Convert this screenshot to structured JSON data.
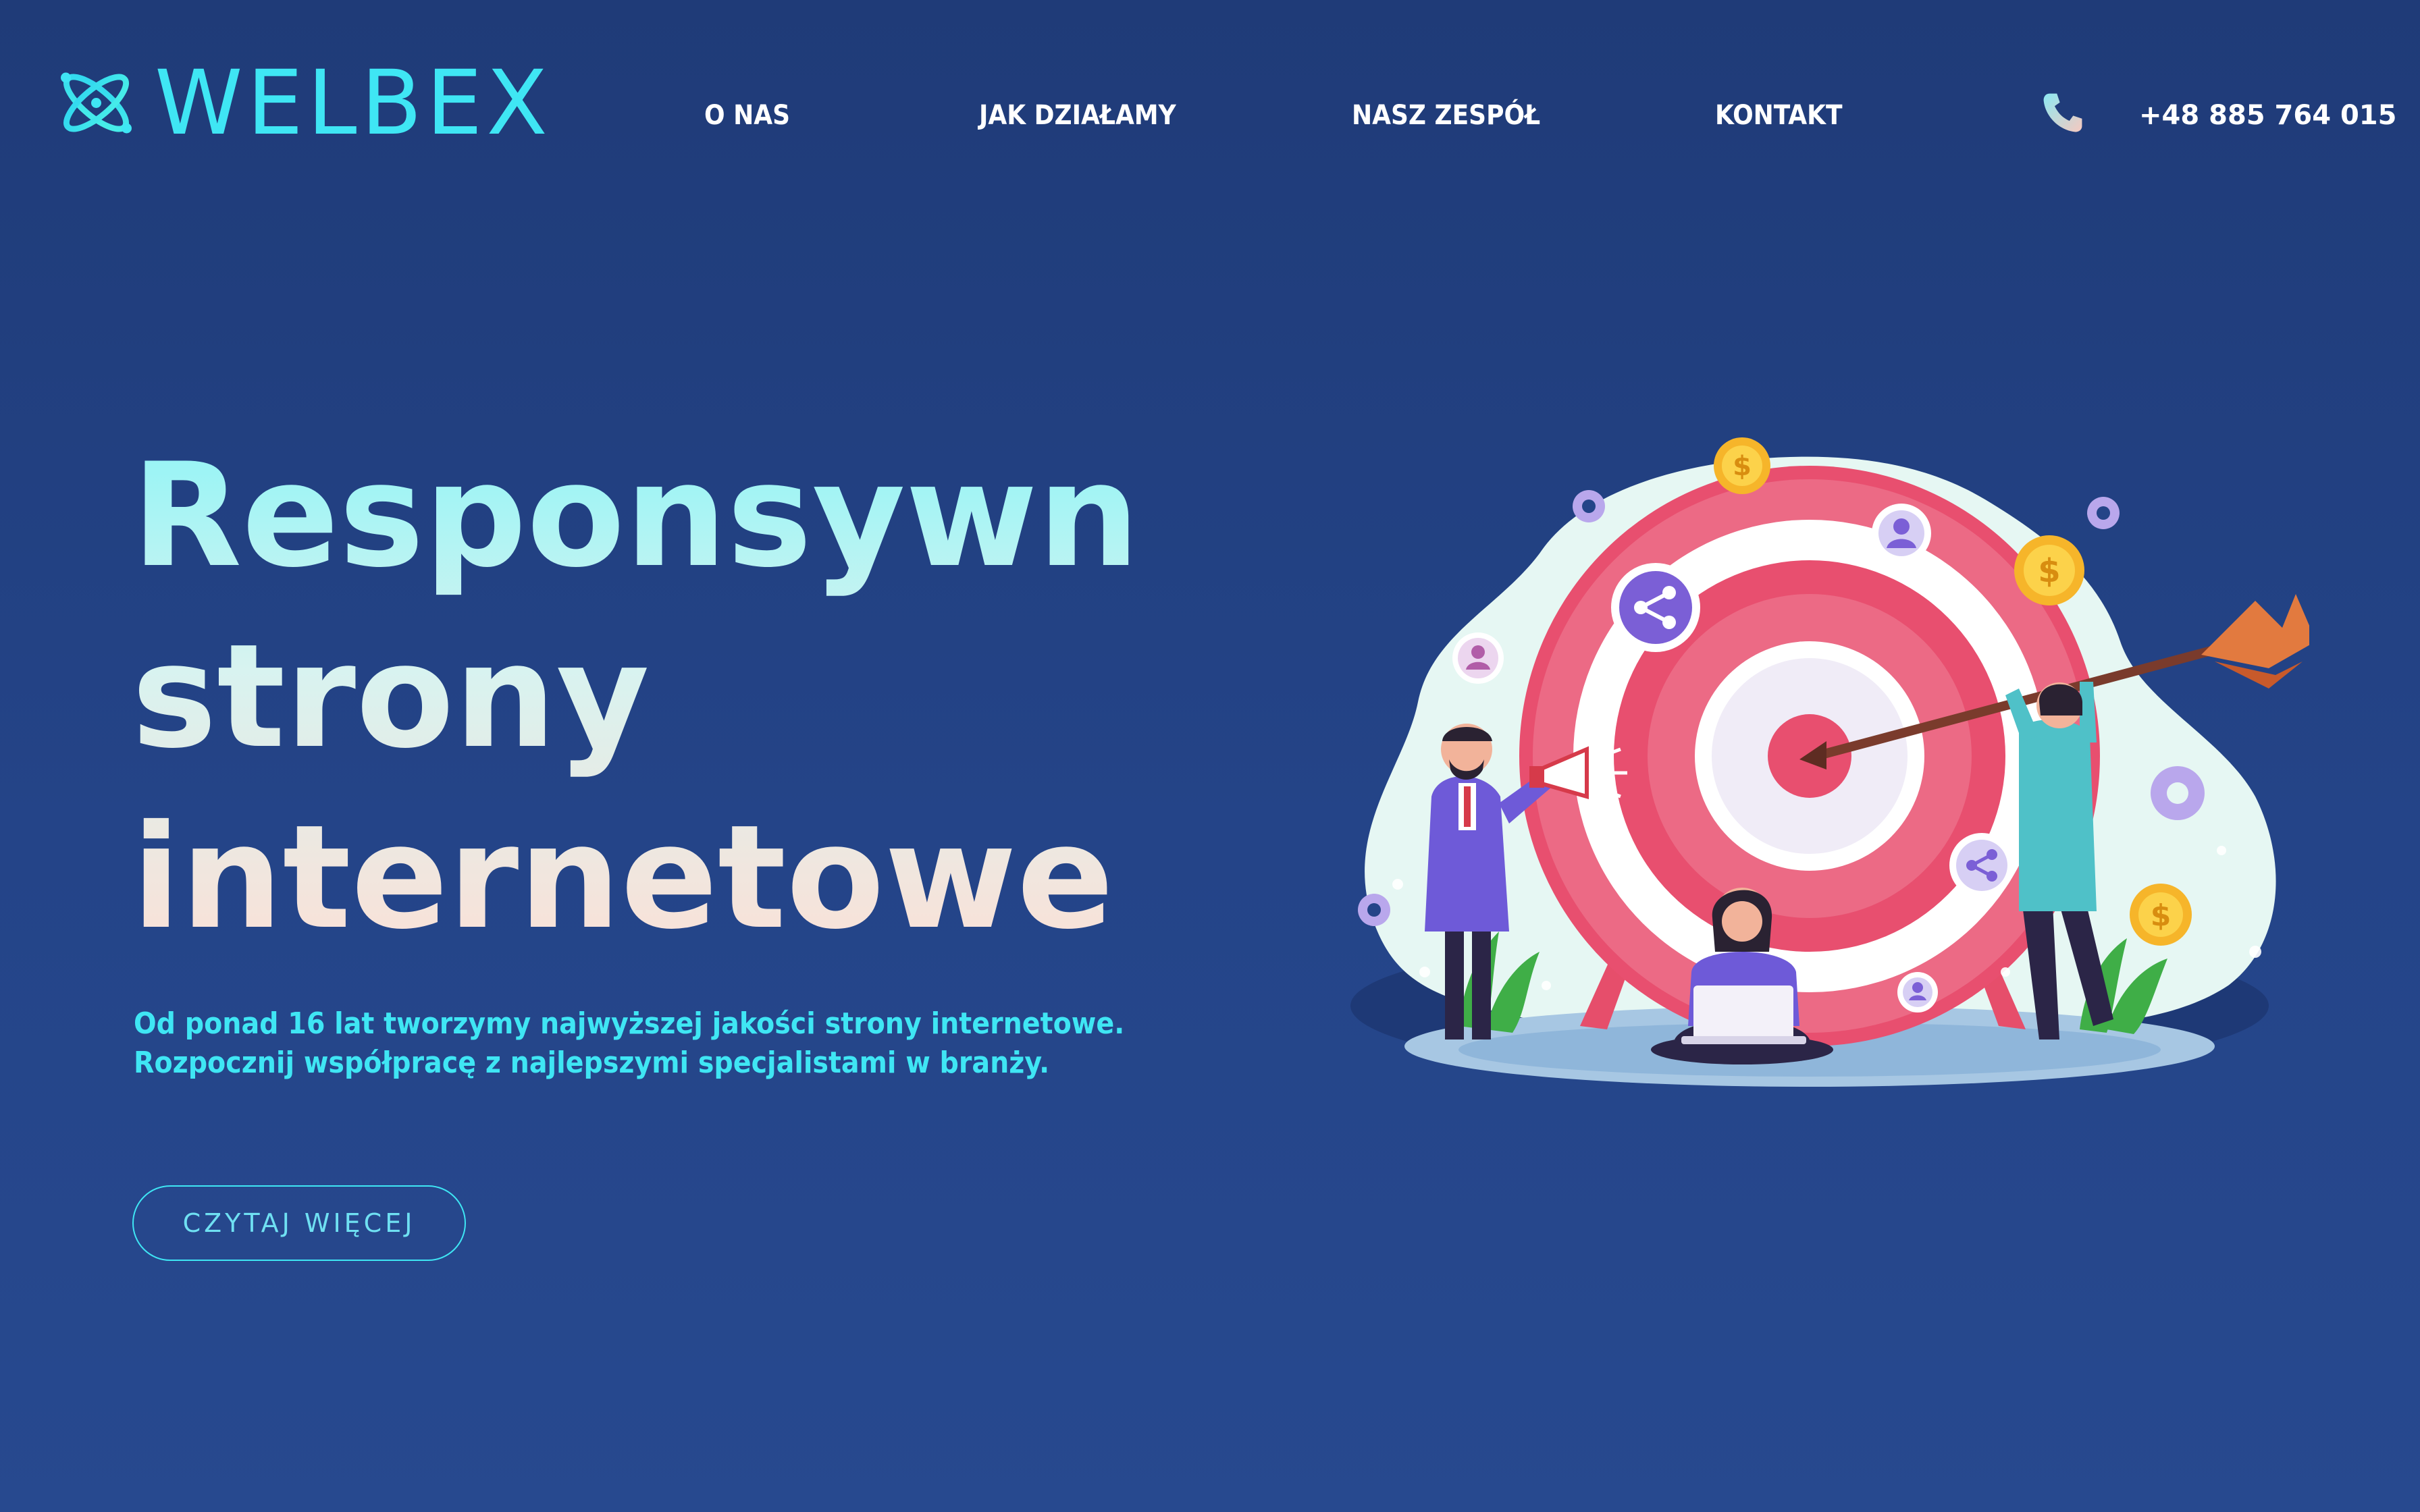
{
  "brand": {
    "name": "WELBEX",
    "accent": "#3fe6f4",
    "background": "#244488"
  },
  "nav": {
    "items": [
      {
        "label": "O NAS"
      },
      {
        "label": "JAK DZIAŁAMY"
      },
      {
        "label": "NASZ ZESPÓŁ"
      },
      {
        "label": "KONTAKT"
      }
    ],
    "phone_icon": "phone-icon",
    "phone": "+48 885 764 015"
  },
  "hero": {
    "title_lines": [
      "Responsywne",
      "strony",
      "internetowe"
    ],
    "subtitle_lines": [
      "Od ponad 16 lat tworzymy najwyższej jakości strony internetowe.",
      "Rozpocznij współpracę z najlepszymi specjalistami w branży."
    ],
    "cta_label": "CZYTAJ WIĘCEJ"
  },
  "illustration": {
    "icons": [
      "target-icon",
      "arrow-icon",
      "megaphone-icon",
      "share-icon",
      "user-icon",
      "dollar-coin-icon",
      "gear-icon",
      "laptop-icon"
    ]
  }
}
